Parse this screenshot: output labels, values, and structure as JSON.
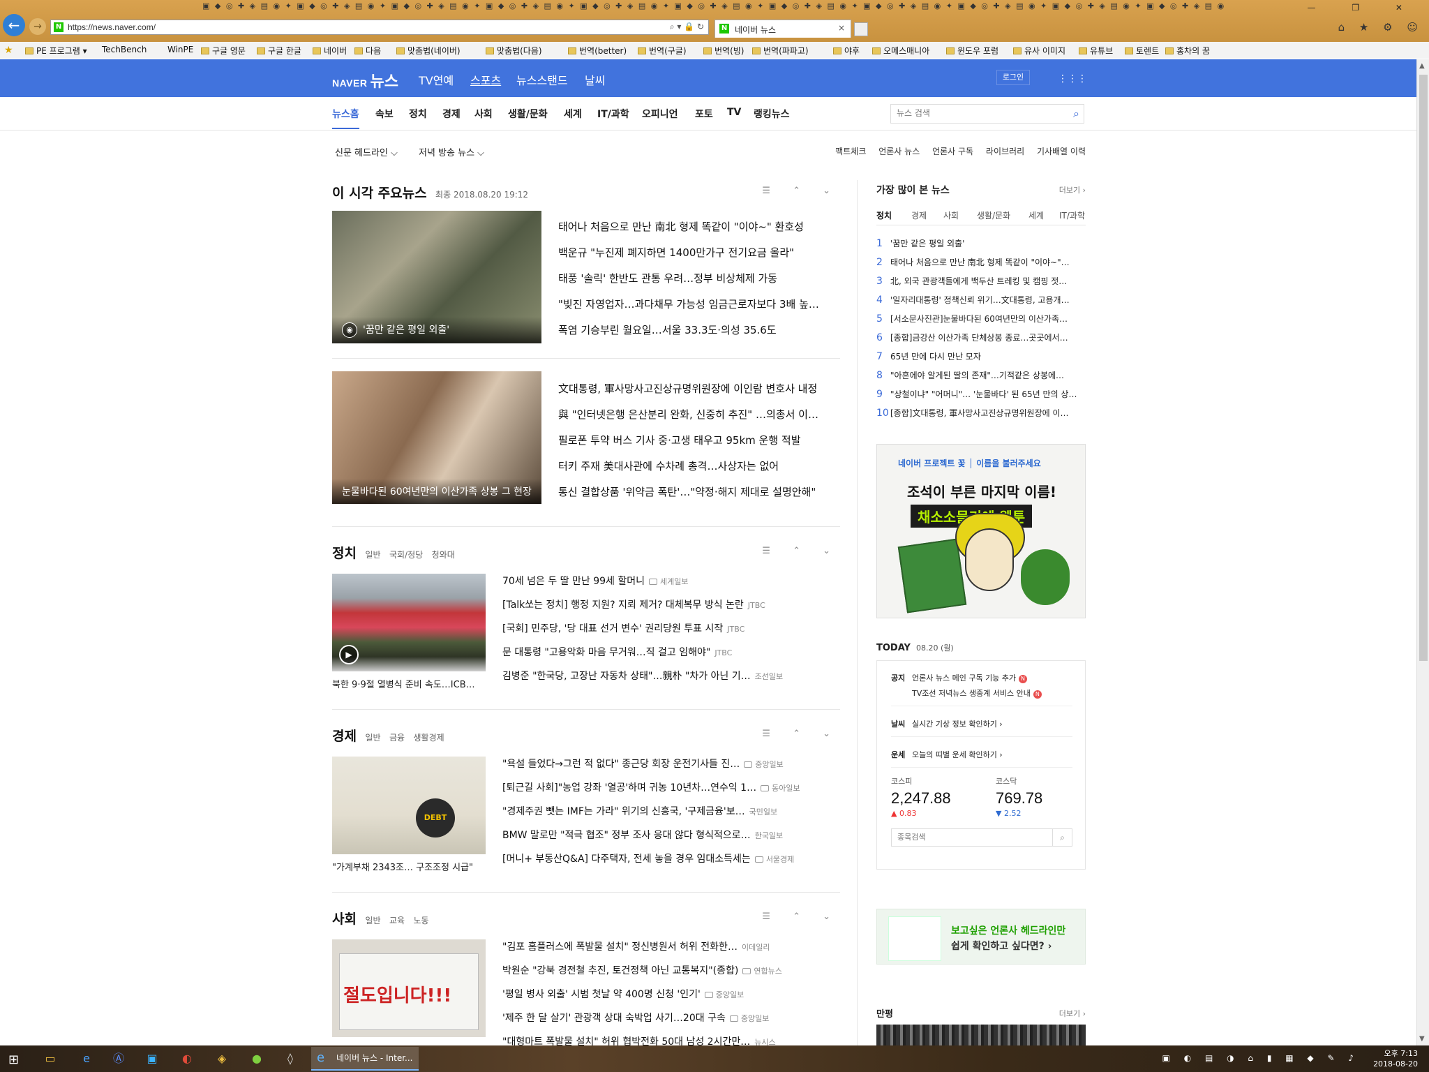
{
  "browser": {
    "url": "https://news.naver.com/",
    "tab_title": "네이버 뉴스",
    "tab_close": "×",
    "back": "←",
    "forward": "→",
    "address_icons": "⌕ ▾ 🔒 ↻",
    "right_icons": "⌂ ★ ⚙ ☺",
    "window_controls": "— ❐ ✕",
    "bookmarks": [
      {
        "label": "PE 프로그램 ▾",
        "folder": true
      },
      {
        "label": "TechBench",
        "folder": false
      },
      {
        "label": "WinPE",
        "folder": false
      },
      {
        "label": "구글 영문",
        "folder": true
      },
      {
        "label": "구글 한글",
        "folder": true
      },
      {
        "label": "네이버",
        "folder": true
      },
      {
        "label": "다음",
        "folder": true
      },
      {
        "label": "맞춤법(네이버)",
        "folder": true
      },
      {
        "label": "맞춤법(다음)",
        "folder": true
      },
      {
        "label": "번역(better)",
        "folder": true
      },
      {
        "label": "번역(구글)",
        "folder": true
      },
      {
        "label": "번역(빙)",
        "folder": true
      },
      {
        "label": "번역(파파고)",
        "folder": true
      },
      {
        "label": "야후",
        "folder": true
      },
      {
        "label": "오메스매니아",
        "folder": true
      },
      {
        "label": "윈도우 포럼",
        "folder": true
      },
      {
        "label": "유사 이미지",
        "folder": true
      },
      {
        "label": "유튜브",
        "folder": true
      },
      {
        "label": "토렌트",
        "folder": true
      },
      {
        "label": "홍차의 꿈",
        "folder": true
      }
    ]
  },
  "header": {
    "logo_naver": "NAVER",
    "logo_news": "뉴스",
    "nav": [
      "TV연예",
      "스포츠",
      "뉴스스탠드",
      "날씨"
    ],
    "login": "로그인",
    "menu_icon": "⋮⋮⋮"
  },
  "subnav": {
    "items": [
      "뉴스홈",
      "속보",
      "정치",
      "경제",
      "사회",
      "생활/문화",
      "세계",
      "IT/과학",
      "오피니언",
      "포토",
      "TV",
      "랭킹뉴스"
    ],
    "search_placeholder": "뉴스 검색",
    "search_icon": "⌕"
  },
  "toolbar": {
    "dropdown1": "신문 헤드라인 ⌵",
    "dropdown2": "저녁 방송 뉴스 ⌵",
    "links": [
      "팩트체크",
      "언론사 뉴스",
      "언론사 구독",
      "라이브러리",
      "기사배열 이력"
    ]
  },
  "main_news": {
    "title": "이 시각 주요뉴스",
    "updated": "최종 2018.08.20 19:12",
    "controls": "☰ ⌃ ⌄",
    "block1": {
      "caption": "'꿈만 같은 평일 외출'",
      "headlines": [
        "태어나 처음으로 만난 南北 형제 똑같이 \"이야~\" 환호성",
        "백운규 \"누진제 폐지하면 1400만가구 전기요금 올라\"",
        "태풍 '솔릭' 한반도 관통 우려…정부 비상체제 가동",
        "\"빚진 자영업자…과다채무 가능성 임금근로자보다 3배 높…",
        "폭염 기승부린 월요일…서울 33.3도·의성 35.6도"
      ]
    },
    "block2": {
      "caption": "눈물바다된 60여년만의 이산가족 상봉 그 현장",
      "headlines": [
        "文대통령, 軍사망사고진상규명위원장에 이인람 변호사 내정",
        "與 \"인터넷은행 은산분리 완화, 신중히 추진\" …의총서 이…",
        "필로폰 투약 버스 기사 중·고생 태우고 95km 운행 적발",
        "터키 주재 美대사관에 수차례 총격…사상자는 없어",
        "통신 결합상품 '위약금 폭탄'…\"약정·해지 제대로 설명안해\""
      ]
    }
  },
  "sections": [
    {
      "title": "정치",
      "subs": [
        "일반",
        "국회/정당",
        "청와대"
      ],
      "thumb_caption": "북한 9·9절 열병식 준비 속도…ICB…",
      "items": [
        {
          "text": "70세 넘은 두 딸 만난 99세 할머니",
          "press": "세계일보",
          "photo": true
        },
        {
          "text": "[Talk쏘는 정치] 행정 지원? 지뢰 제거? 대체복무 방식 논란",
          "press": "JTBC",
          "photo": false
        },
        {
          "text": "[국회] 민주당, '당 대표 선거 변수' 권리당원 투표 시작",
          "press": "JTBC",
          "photo": false
        },
        {
          "text": "문 대통령 \"고용악화 마음 무거워…직 걸고 임해야\"",
          "press": "JTBC",
          "photo": false
        },
        {
          "text": "김병준 \"한국당, 고장난 자동차 상태\"…親朴 \"차가 아닌 기…",
          "press": "조선일보",
          "photo": false
        }
      ]
    },
    {
      "title": "경제",
      "subs": [
        "일반",
        "금융",
        "생활경제"
      ],
      "thumb_caption": "\"가계부채 2343조… 구조조정 시급\"",
      "items": [
        {
          "text": "\"욕설 들었다→그런 적 없다\" 종근당 회장 운전기사들 진…",
          "press": "중앙일보",
          "photo": true
        },
        {
          "text": "[퇴근길 사회]\"농업 강좌 '열공'하며 귀농 10년차…연수익 1…",
          "press": "동아일보",
          "photo": true
        },
        {
          "text": "\"경제주권 뺏는 IMF는 가라\" 위기의 신흥국, '구제금융'보…",
          "press": "국민일보",
          "photo": false
        },
        {
          "text": "BMW 말로만 \"적극 협조\" 정부 조사 응대 않다 형식적으로…",
          "press": "한국일보",
          "photo": false
        },
        {
          "text": "[머니+ 부동산Q&A] 다주택자, 전세 놓을 경우 임대소득세는",
          "press": "서울경제",
          "photo": true
        }
      ]
    },
    {
      "title": "사회",
      "subs": [
        "일반",
        "교육",
        "노동"
      ],
      "thumb_sign": "절도입니다!!!",
      "items": [
        {
          "text": "\"김포 홈플러스에 폭발물 설치\" 정신병원서 허위 전화한…",
          "press": "이데일리",
          "photo": false
        },
        {
          "text": "박원순 \"강북 경전철 추진, 토건정책 아닌 교통복지\"(종합)",
          "press": "연합뉴스",
          "photo": true
        },
        {
          "text": "'평일 병사 외출' 시범 첫날 약 400명 신청 '인기'",
          "press": "중앙일보",
          "photo": true
        },
        {
          "text": "'제주 한 달 살기' 관광객 상대 숙박업 사기…20대 구속",
          "press": "중앙일보",
          "photo": true
        },
        {
          "text": "\"대형마트 폭발물 설치\" 허위 협박전화 50대 남성 2시간만…",
          "press": "뉴시스",
          "photo": false
        }
      ]
    }
  ],
  "ranking": {
    "title": "가장 많이 본 뉴스",
    "more": "더보기 ›",
    "tabs": [
      "정치",
      "경제",
      "사회",
      "생활/문화",
      "세계",
      "IT/과학"
    ],
    "items": [
      "'꿈만 같은 평일 외출'",
      "태어나 처음으로 만난 南北 형제 똑같이 \"이야~\"…",
      "北, 외국 관광객들에게 백두산 트레킹 및 캠핑 젓…",
      "'일자리대통령' 정책신뢰 위기…文대통령, 고용개…",
      "[서소문사진관]눈물바다된 60여년만의 이산가족…",
      "[종합]금강산 이산가족 단체상봉 종료…곳곳에서…",
      "65년 만에 다시 만난 모자",
      "\"아흔에야 알게된 딸의 존재\"…기적같은 상봉에…",
      "\"상철이냐\" \"어머니\"… '눈물바다' 된 65년 만의 상…",
      "[종합]文대통령, 軍사망사고진상규명위원장에 이…"
    ]
  },
  "ad": {
    "top": "네이버 프로젝트 꽃 │ 이름을 불러주세요",
    "line1": "조석이 부른 마지막 이름!",
    "line2": "채소소믈리에 웹툰"
  },
  "today": {
    "title": "TODAY",
    "date": "08.20 (월)",
    "notice_label": "공지",
    "notices": [
      "언론사 뉴스 메인 구독 기능 추가",
      "TV조선 저녁뉴스 생중계 서비스 안내"
    ],
    "new_badge": "N",
    "weather_label": "날씨",
    "weather": "실시간 기상 정보 확인하기 ›",
    "fortune_label": "운세",
    "fortune": "오늘의 띠별 운세 확인하기 ›",
    "kospi_name": "코스피",
    "kospi_value": "2,247.88",
    "kospi_change": "▲ 0.83",
    "kosdaq_name": "코스닥",
    "kosdaq_value": "769.78",
    "kosdaq_change": "▼ 2.52",
    "stock_placeholder": "종목검색"
  },
  "banner2": {
    "line1": "보고싶은 언론사 헤드라인만",
    "line2": "쉽게 확인하고 싶다면? ›"
  },
  "cartoon": {
    "title": "만평",
    "more": "더보기 ›"
  },
  "taskbar": {
    "active_title": "네이버 뉴스 - Inter...",
    "time": "오후 7:13",
    "date": "2018-08-20"
  }
}
